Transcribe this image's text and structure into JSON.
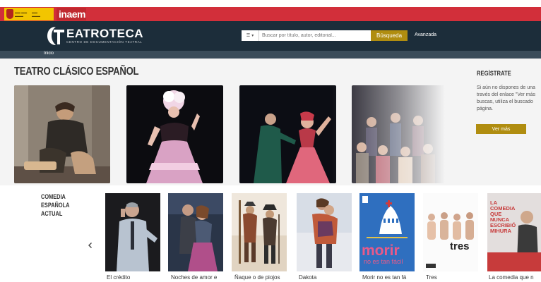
{
  "header": {
    "inaem": "inaem",
    "brand_name": "EATROTECA",
    "brand_sub": "CENTRO DE DOCUMENTACIÓN TEATRAL",
    "search_placeholder": "Buscar por título, autor, editorial...",
    "search_button": "Búsqueda",
    "advanced": "Avanzada"
  },
  "breadcrumb": "Inicio",
  "section": {
    "title": "TEATRO CLÁSICO ESPAÑOL"
  },
  "sidebar": {
    "title": "REGÍSTRATE",
    "lines": [
      "Si aún no dispones de una",
      "través del enlace \"Ver más",
      "buscas, utiliza el buscado",
      "página."
    ],
    "button": "Ver más"
  },
  "row": {
    "title_line1": "COMEDIA ESPAÑOLA",
    "title_line2": "ACTUAL",
    "items": [
      {
        "title": "El crédito"
      },
      {
        "title": "Noches de amor e"
      },
      {
        "title": "Ñaque o de piojos"
      },
      {
        "title": "Dakota"
      },
      {
        "title": "Morir no es tan fá"
      },
      {
        "title": "Tres"
      },
      {
        "title": "La comedia que n"
      }
    ],
    "posters": {
      "morir_big": "morir",
      "morir_small": "no es tan fácil",
      "tres": "tres",
      "comedia_line1": "LA",
      "comedia_line2": "COMEDIA",
      "comedia_line3": "QUE",
      "comedia_line4": "NUNCA",
      "comedia_line5": "ESCRIBIÓ",
      "comedia_line6": "MIHURA"
    }
  },
  "colors": {
    "gov_red": "#d22f3a",
    "header_dark": "#1c2d3a",
    "accent_gold": "#b08d10"
  }
}
